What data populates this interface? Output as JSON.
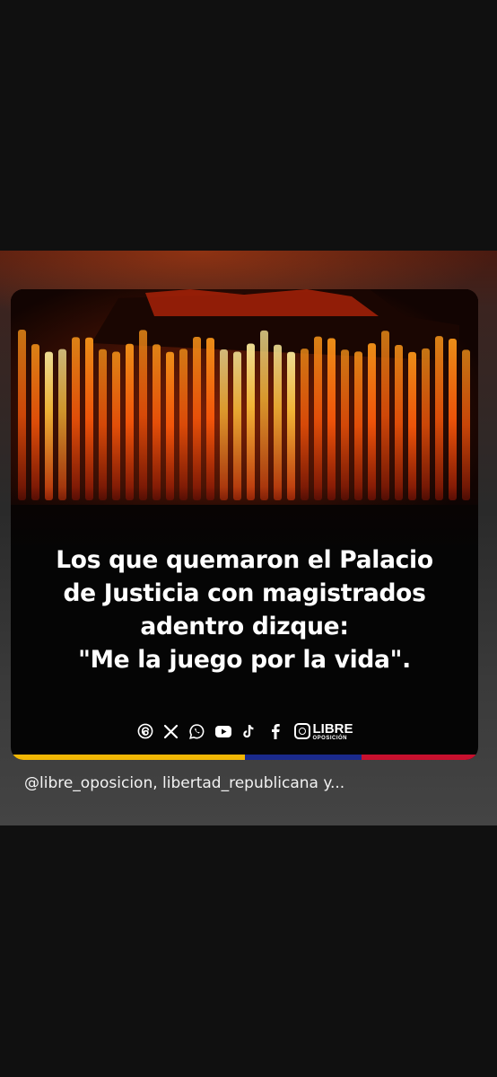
{
  "post": {
    "headline_lines": [
      "Los que quemaron el Palacio",
      "de Justicia con magistrados",
      "adentro dizque:",
      "\"Me la juego por la vida\"."
    ],
    "brand": {
      "name": "LIBRE",
      "subtitle": "OPOSICIÓN"
    },
    "social_icons": [
      "threads-icon",
      "x-icon",
      "whatsapp-icon",
      "youtube-icon",
      "tiktok-icon",
      "facebook-icon",
      "instagram-icon"
    ],
    "flag_colors": [
      "#f2b705",
      "#1a2a8c",
      "#c8102e"
    ],
    "caption": "@libre_oposicion, libertad_republicana y..."
  }
}
